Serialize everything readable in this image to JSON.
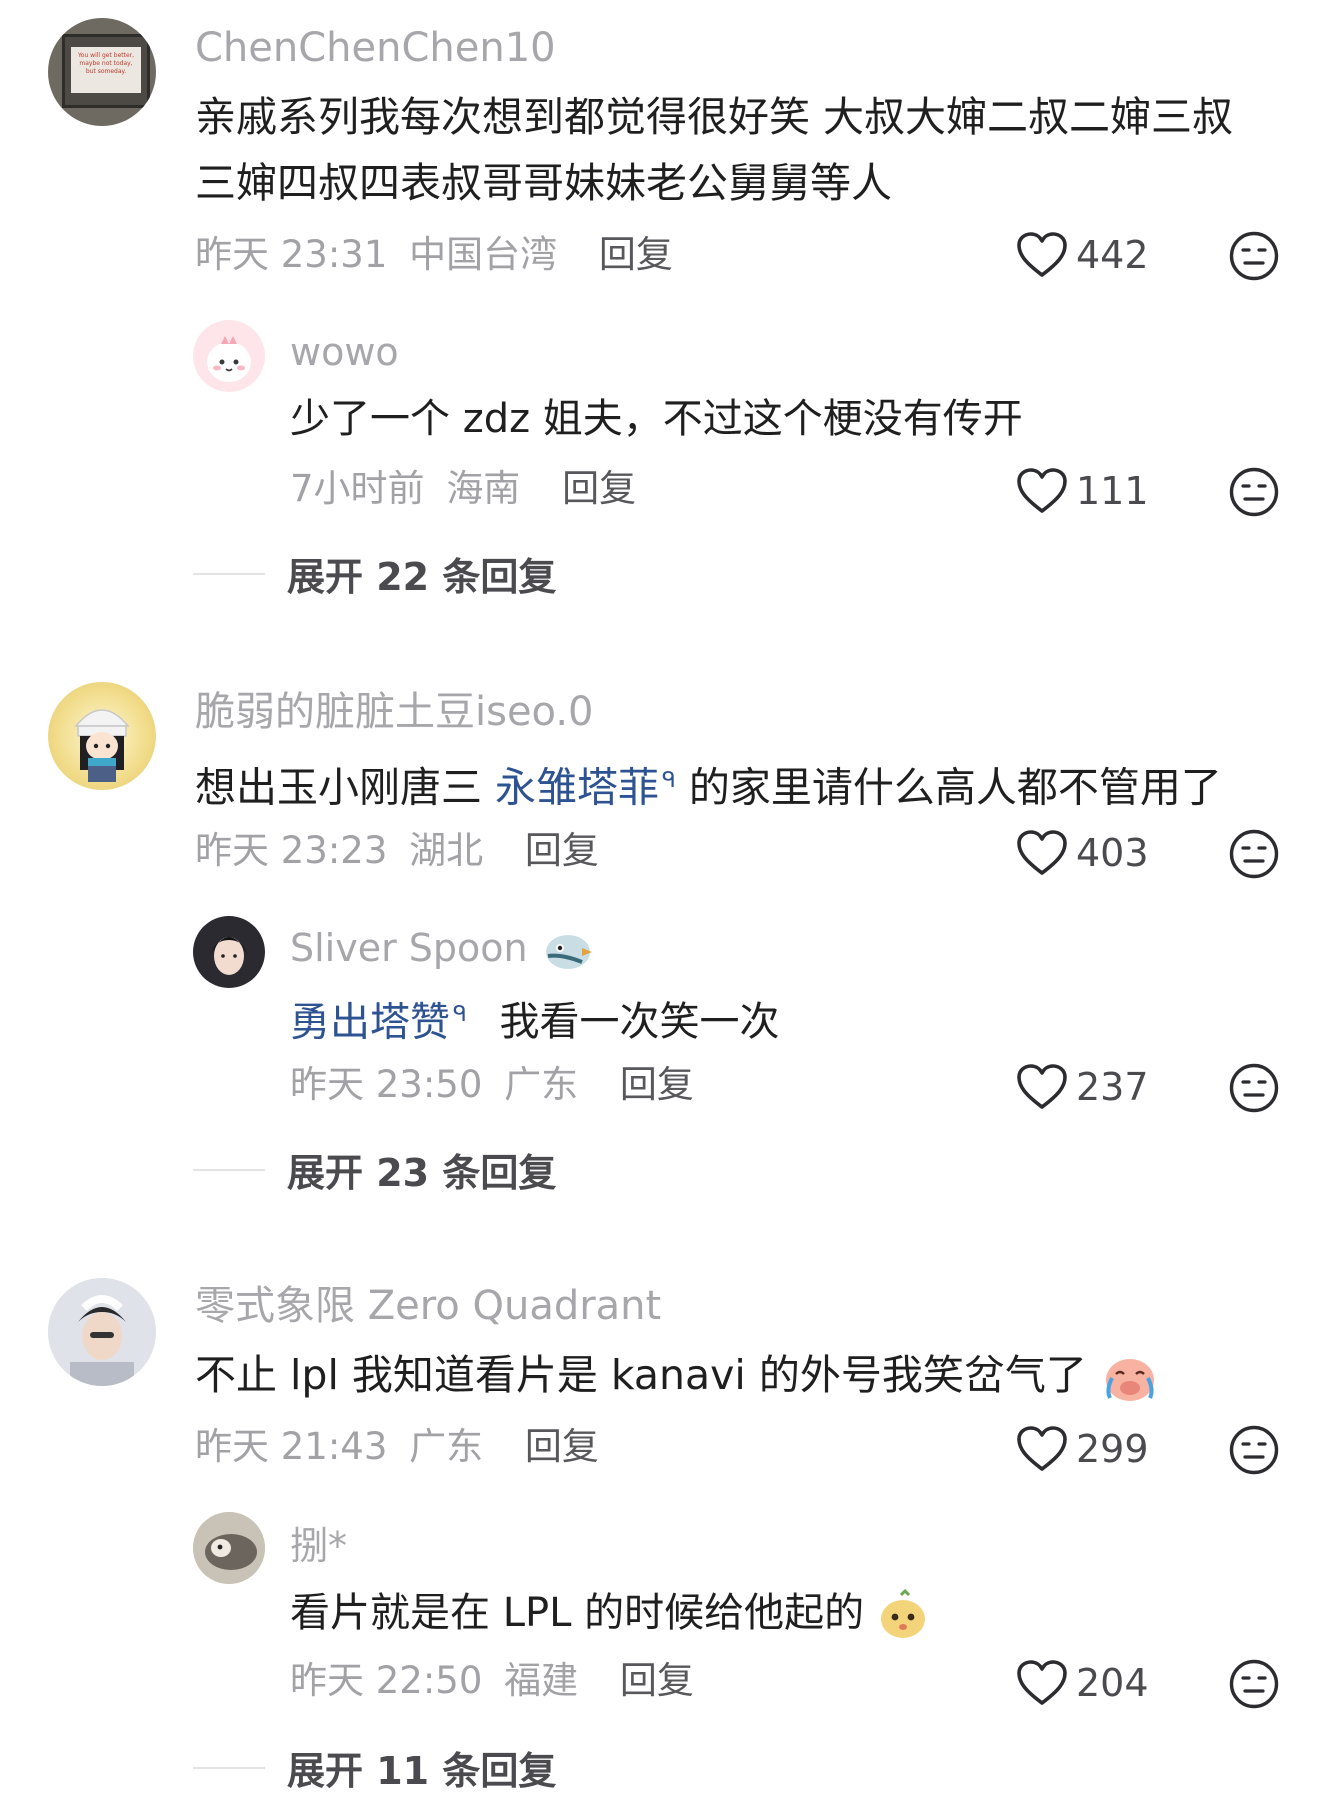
{
  "comments": [
    {
      "user": "ChenChenChen10",
      "avatar_text": "You will get better, maybe not today, but someday.",
      "text_line1": "亲戚系列我每次想到都觉得很好笑 大叔大婶二叔二婶三叔",
      "text_line2": "三婶四叔四表叔哥哥妹妹老公舅舅等人",
      "time": "昨天 23:31",
      "location": "中国台湾",
      "reply_label": "回复",
      "likes": "442",
      "reply": {
        "user": "wowo",
        "text": "少了一个 zdz 姐夫，不过这个梗没有传开",
        "time": "7小时前",
        "location": "海南",
        "reply_label": "回复",
        "likes": "111"
      },
      "expand_label": "展开 22 条回复"
    },
    {
      "user": "脆弱的脏脏土豆iseo.0",
      "text_prefix": "想出玉小刚唐三 ",
      "text_link": "永雏塔菲",
      "text_suffix": " 的家里请什么高人都不管用了",
      "time": "昨天 23:23",
      "location": "湖北",
      "reply_label": "回复",
      "likes": "403",
      "reply": {
        "user": "Sliver Spoon",
        "text_link": "勇出塔赞",
        "text_suffix": "我看一次笑一次",
        "time": "昨天 23:50",
        "location": "广东",
        "reply_label": "回复",
        "likes": "237"
      },
      "expand_label": "展开 23 条回复"
    },
    {
      "user": "零式象限 Zero Quadrant",
      "text": "不止 lpl 我知道看片是 kanavi 的外号我笑岔气了",
      "time": "昨天 21:43",
      "location": "广东",
      "reply_label": "回复",
      "likes": "299",
      "reply": {
        "user": "捌*",
        "text": "看片就是在 LPL 的时候给他起的",
        "time": "昨天 22:50",
        "location": "福建",
        "reply_label": "回复",
        "likes": "204"
      },
      "expand_label": "展开 11 条回复"
    }
  ],
  "icons": {
    "like": "heart-outline-icon",
    "dislike": "neutral-face-icon",
    "search_marker": "search-icon",
    "emoji_laugh_cry": "crying-laughing-pig-emoji",
    "emoji_bird": "bird-emoji",
    "emoji_cat": "cat-face-emoji"
  },
  "colors": {
    "username": "#a6a6ab",
    "text": "#1f1f1f",
    "link": "#2e5393",
    "meta": "#a1a1a6"
  }
}
